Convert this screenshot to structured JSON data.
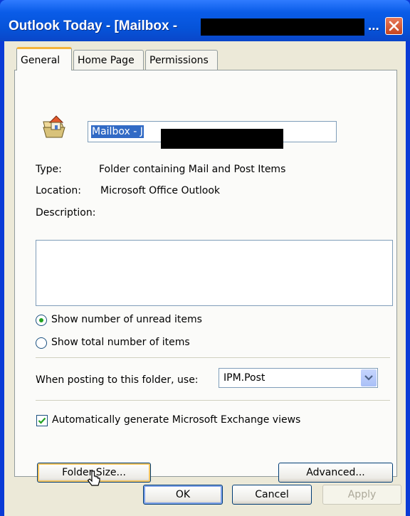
{
  "window": {
    "title_prefix": "Outlook Today - [Mailbox -",
    "title_suffix": "..."
  },
  "tabs": [
    {
      "label": "General",
      "active": true
    },
    {
      "label": "Home Page",
      "active": false
    },
    {
      "label": "Permissions",
      "active": false
    }
  ],
  "general": {
    "folder_name_value": "Mailbox - J",
    "type_label": "Type:",
    "type_value": "Folder containing Mail and Post Items",
    "location_label": "Location:",
    "location_value": "Microsoft Office Outlook",
    "description_label": "Description:",
    "description_value": "",
    "radio_unread_label": "Show number of unread items",
    "radio_total_label": "Show total number of items",
    "radio_unread_checked": true,
    "posting_label": "When posting to this folder, use:",
    "posting_value": "IPM.Post",
    "auto_views_label": "Automatically generate Microsoft Exchange views",
    "auto_views_checked": true,
    "folder_size_button": "Folder Size...",
    "advanced_button": "Advanced..."
  },
  "footer": {
    "ok_button": "OK",
    "cancel_button": "Cancel",
    "apply_button": "Apply"
  },
  "colors": {
    "title_bar": "#0a5ce8",
    "dialog_face": "#ece9d8",
    "selection": "#316ac5",
    "focus_accent": "#f5c55f",
    "radio_dot": "#21a121"
  },
  "icons": [
    "folder-home-icon",
    "close-icon",
    "chevron-down-icon",
    "checkmark-icon",
    "mouse-cursor-icon"
  ]
}
